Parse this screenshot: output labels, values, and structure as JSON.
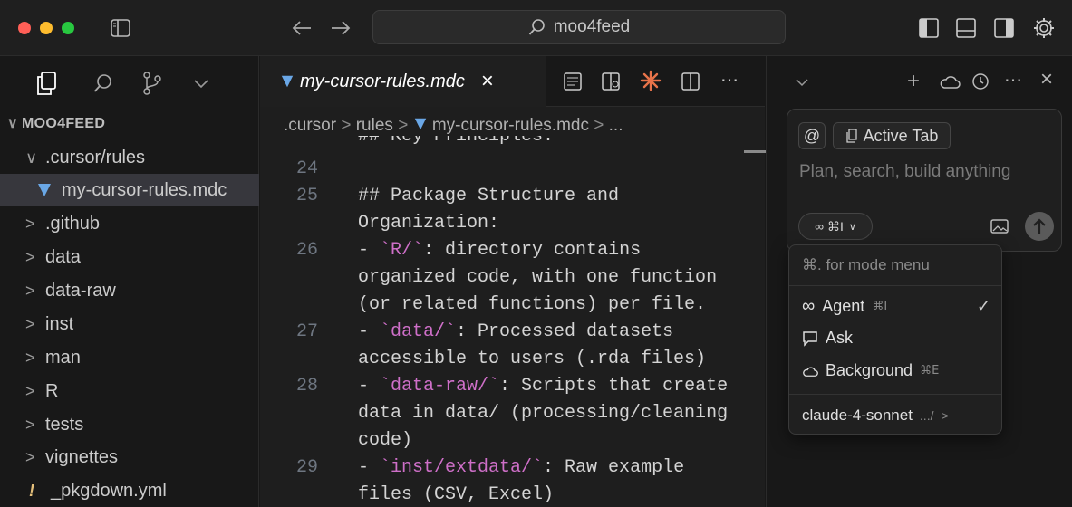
{
  "titlebar": {
    "search_text": "moo4feed",
    "back_icon": "arrow-left-icon",
    "forward_icon": "arrow-right-icon",
    "traffic_colors": [
      "#ff5f57",
      "#febc2e",
      "#28c840"
    ]
  },
  "sidebar": {
    "project_name": "MOO4FEED",
    "items": [
      {
        "label": ".cursor/rules",
        "chevron": "∨"
      },
      {
        "label": "my-cursor-rules.mdc",
        "chevron": ""
      },
      {
        "label": ".github",
        "chevron": ">"
      },
      {
        "label": "data",
        "chevron": ">"
      },
      {
        "label": "data-raw",
        "chevron": ">"
      },
      {
        "label": "inst",
        "chevron": ">"
      },
      {
        "label": "man",
        "chevron": ">"
      },
      {
        "label": "R",
        "chevron": ">"
      },
      {
        "label": "tests",
        "chevron": ">"
      },
      {
        "label": "vignettes",
        "chevron": ">"
      },
      {
        "label": "_pkgdown.yml",
        "chevron": "!"
      }
    ]
  },
  "editor": {
    "tab_label": "my-cursor-rules.mdc",
    "tab_close": "×",
    "breadcrumb": {
      "part1": ".cursor",
      "part2": "rules",
      "part3": "my-cursor-rules.mdc",
      "ellipsis": "..."
    },
    "lines": [
      {
        "ln": "",
        "code": "## Key Principles:"
      },
      {
        "ln": "24",
        "code": ""
      },
      {
        "ln": "25",
        "code": "## Package Structure and"
      },
      {
        "ln": "",
        "code": "Organization:"
      },
      {
        "ln": "26",
        "pre": "- ",
        "str": "`R/`",
        "post": ": directory contains"
      },
      {
        "ln": "",
        "code": "organized code, with one function"
      },
      {
        "ln": "",
        "code": "(or related functions) per file."
      },
      {
        "ln": "27",
        "pre": "- ",
        "str": "`data/`",
        "post": ": Processed datasets"
      },
      {
        "ln": "",
        "code": "accessible to users (.rda files)"
      },
      {
        "ln": "28",
        "pre": "- ",
        "str": "`data-raw/`",
        "post": ": Scripts that create"
      },
      {
        "ln": "",
        "code": "data in data/ (processing/cleaning"
      },
      {
        "ln": "",
        "code": "code)"
      },
      {
        "ln": "29",
        "pre": "- ",
        "str": "`inst/extdata/`",
        "post": ": Raw example"
      },
      {
        "ln": "",
        "code": "files (CSV, Excel)"
      }
    ]
  },
  "chat": {
    "at_label": "@",
    "active_tab_label": "Active Tab",
    "placeholder": "Plan, search, build anything",
    "mode_chip": "∞ ⌘I",
    "menu": {
      "hint": "⌘. for mode menu",
      "items": [
        {
          "label": "Agent",
          "kbd": "⌘I",
          "icon": "∞",
          "checked": "✓"
        },
        {
          "label": "Ask",
          "kbd": "",
          "icon": "chat-bubble-icon",
          "checked": ""
        },
        {
          "label": "Background",
          "kbd": "⌘E",
          "icon": "cloud-icon",
          "checked": ""
        }
      ],
      "model": "claude-4-sonnet",
      "model_suffix": ".../"
    }
  }
}
